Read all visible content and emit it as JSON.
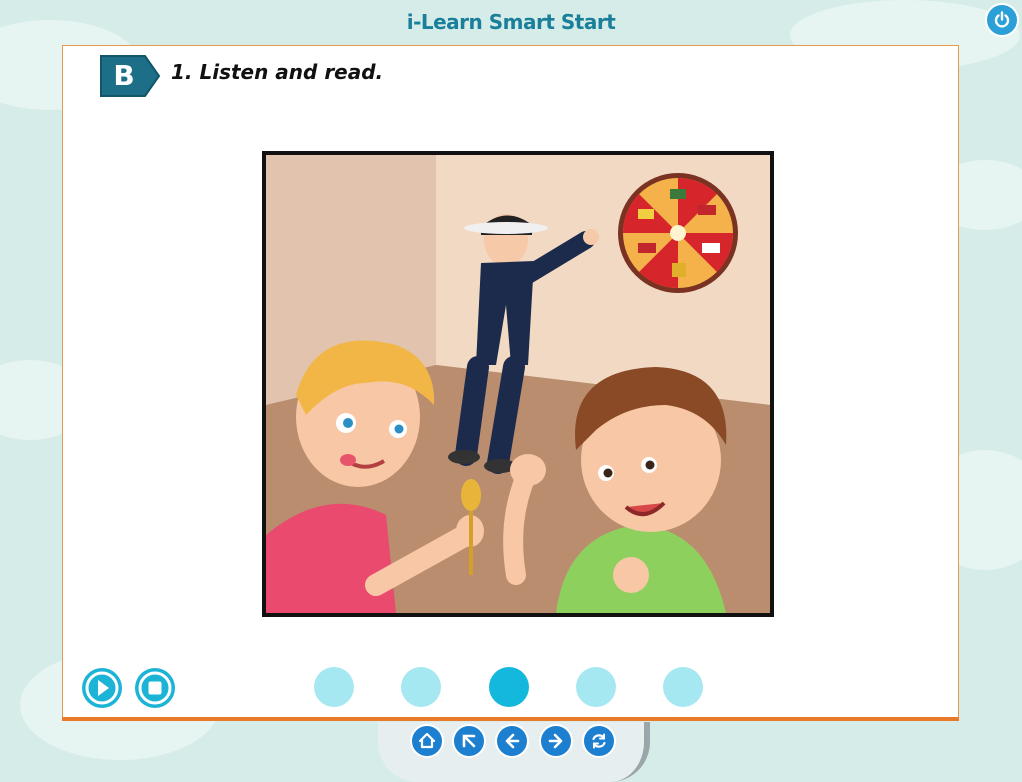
{
  "app": {
    "title": "i-Learn Smart Start"
  },
  "section": {
    "letter": "B",
    "instruction": "1. Listen and read."
  },
  "icons": {
    "power": "power-icon",
    "play": "play-icon",
    "stop": "stop-icon",
    "home": "home-icon",
    "back_up": "arrow-up-left-icon",
    "prev": "arrow-left-icon",
    "next": "arrow-right-icon",
    "refresh": "refresh-icon"
  },
  "pagination": {
    "count": 5,
    "active_index": 3
  },
  "colors": {
    "brand_title": "#1a7f9a",
    "accent": "#1bb3d6",
    "dot_inactive": "#a6e8f2",
    "dot_active": "#14b8dc",
    "panel_border": "#e89a4a",
    "tag": "#1c6f86"
  }
}
